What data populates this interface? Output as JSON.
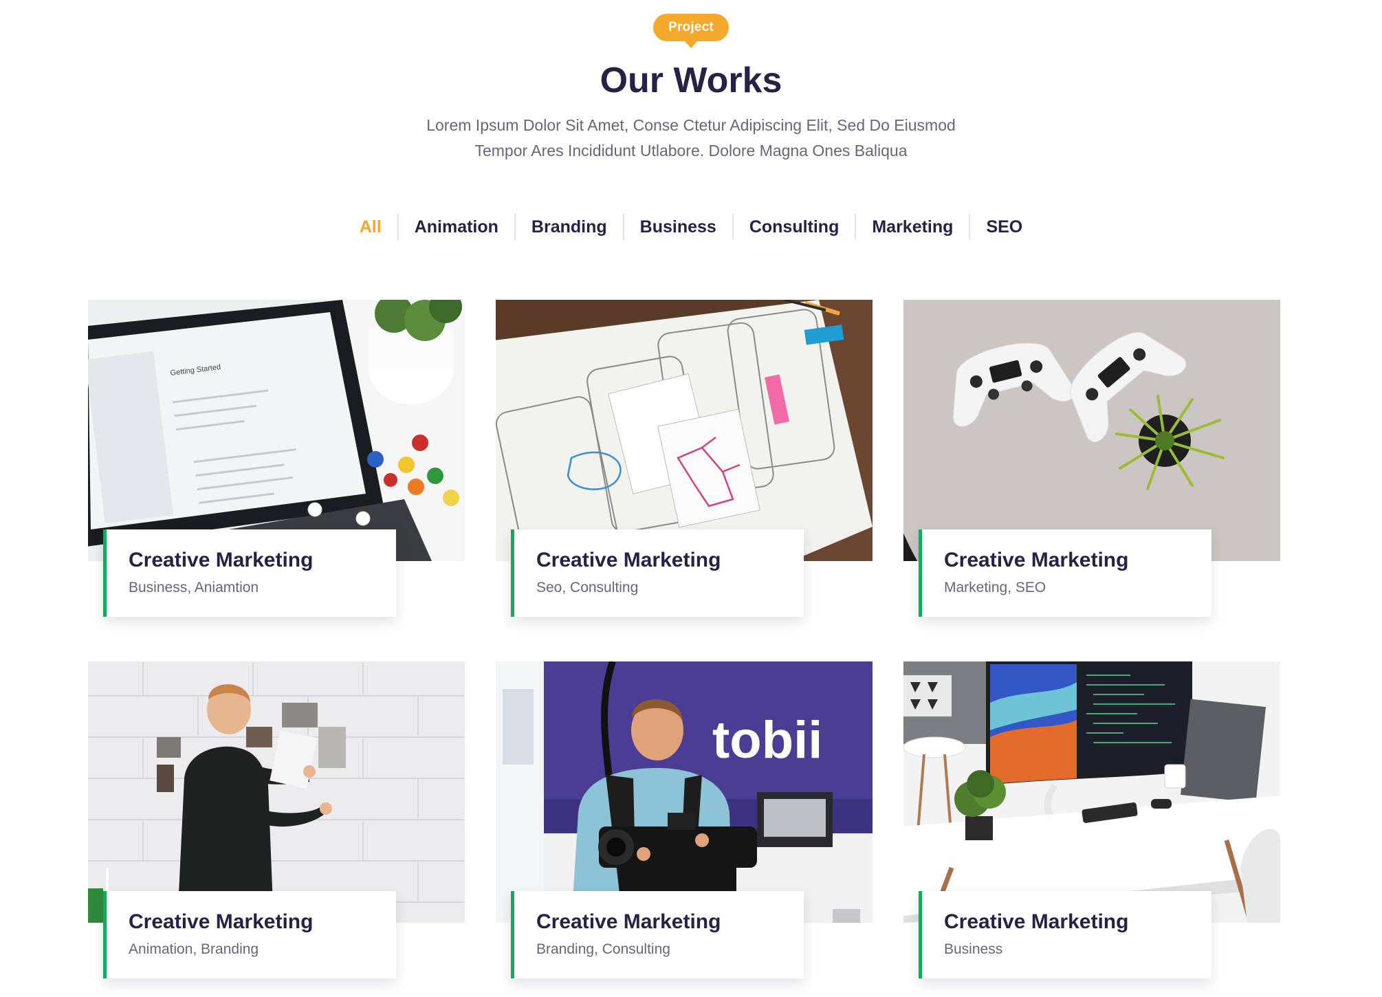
{
  "section": {
    "badge": "Project",
    "title": "Our Works",
    "subtitle_line1": "Lorem Ipsum Dolor Sit Amet, Conse Ctetur Adipiscing Elit, Sed Do Eiusmod",
    "subtitle_line2": "Tempor Ares Incididunt Utlabore. Dolore Magna Ones Baliqua"
  },
  "filters": [
    {
      "label": "All",
      "active": true
    },
    {
      "label": "Animation",
      "active": false
    },
    {
      "label": "Branding",
      "active": false
    },
    {
      "label": "Business",
      "active": false
    },
    {
      "label": "Consulting",
      "active": false
    },
    {
      "label": "Marketing",
      "active": false
    },
    {
      "label": "SEO",
      "active": false
    }
  ],
  "works": [
    {
      "title": "Creative Marketing",
      "tags": "Business, Aniamtion",
      "image": "tablet-desk-photo"
    },
    {
      "title": "Creative Marketing",
      "tags": "Seo, Consulting",
      "image": "wireframe-sketches-photo"
    },
    {
      "title": "Creative Marketing",
      "tags": "Marketing, SEO",
      "image": "game-controllers-photo"
    },
    {
      "title": "Creative Marketing",
      "tags": "Animation, Branding",
      "image": "moodboard-wall-photo"
    },
    {
      "title": "Creative Marketing",
      "tags": "Branding, Consulting",
      "image": "camera-operator-photo",
      "sign_text": "tobii"
    },
    {
      "title": "Creative Marketing",
      "tags": "Business",
      "image": "workspace-monitor-photo"
    }
  ],
  "colors": {
    "accent": "#f4a82c",
    "heading": "#262145",
    "body_text": "#676677",
    "card_border": "#1fa35f"
  }
}
